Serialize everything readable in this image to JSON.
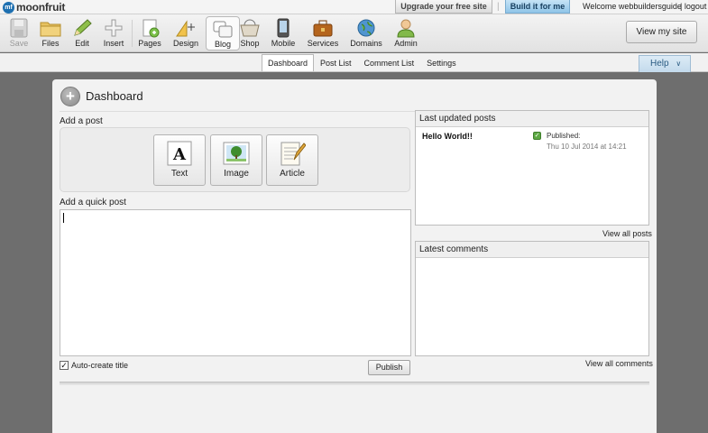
{
  "brand": {
    "logo_mark": "mf",
    "name": "moonfruit"
  },
  "topbar": {
    "upgrade_label": "Upgrade your free site",
    "separator": "|",
    "build_label": "Build it for me",
    "welcome": "Welcome webbuildersguide",
    "logout": "| logout"
  },
  "toolbar": {
    "save": "Save",
    "files": "Files",
    "edit": "Edit",
    "insert": "Insert",
    "pages": "Pages",
    "design": "Design",
    "blog": "Blog",
    "shop": "Shop",
    "mobile": "Mobile",
    "services": "Services",
    "domains": "Domains",
    "admin": "Admin",
    "view_site": "View my site"
  },
  "subnav": {
    "tabs": [
      "Dashboard",
      "Post List",
      "Comment List",
      "Settings"
    ],
    "active": "Dashboard",
    "help": "Help"
  },
  "dashboard": {
    "title": "Dashboard",
    "add_post_label": "Add a post",
    "post_types": [
      "Text",
      "Image",
      "Article"
    ],
    "quick_post_label": "Add a quick post",
    "auto_title_label": "Auto-create title",
    "auto_title_checked": true,
    "publish_label": "Publish",
    "last_updated": {
      "header": "Last updated posts",
      "posts": [
        {
          "title": "Hello World!!",
          "status": "Published:",
          "date": "Thu 10 Jul 2014 at 14:21"
        }
      ],
      "view_all": "View all posts"
    },
    "comments": {
      "header": "Latest comments",
      "view_all": "View all comments"
    }
  },
  "colors": {
    "background": "#6e6e6e",
    "accent_blue": "#8fc4e8",
    "published_green": "#5da843"
  }
}
